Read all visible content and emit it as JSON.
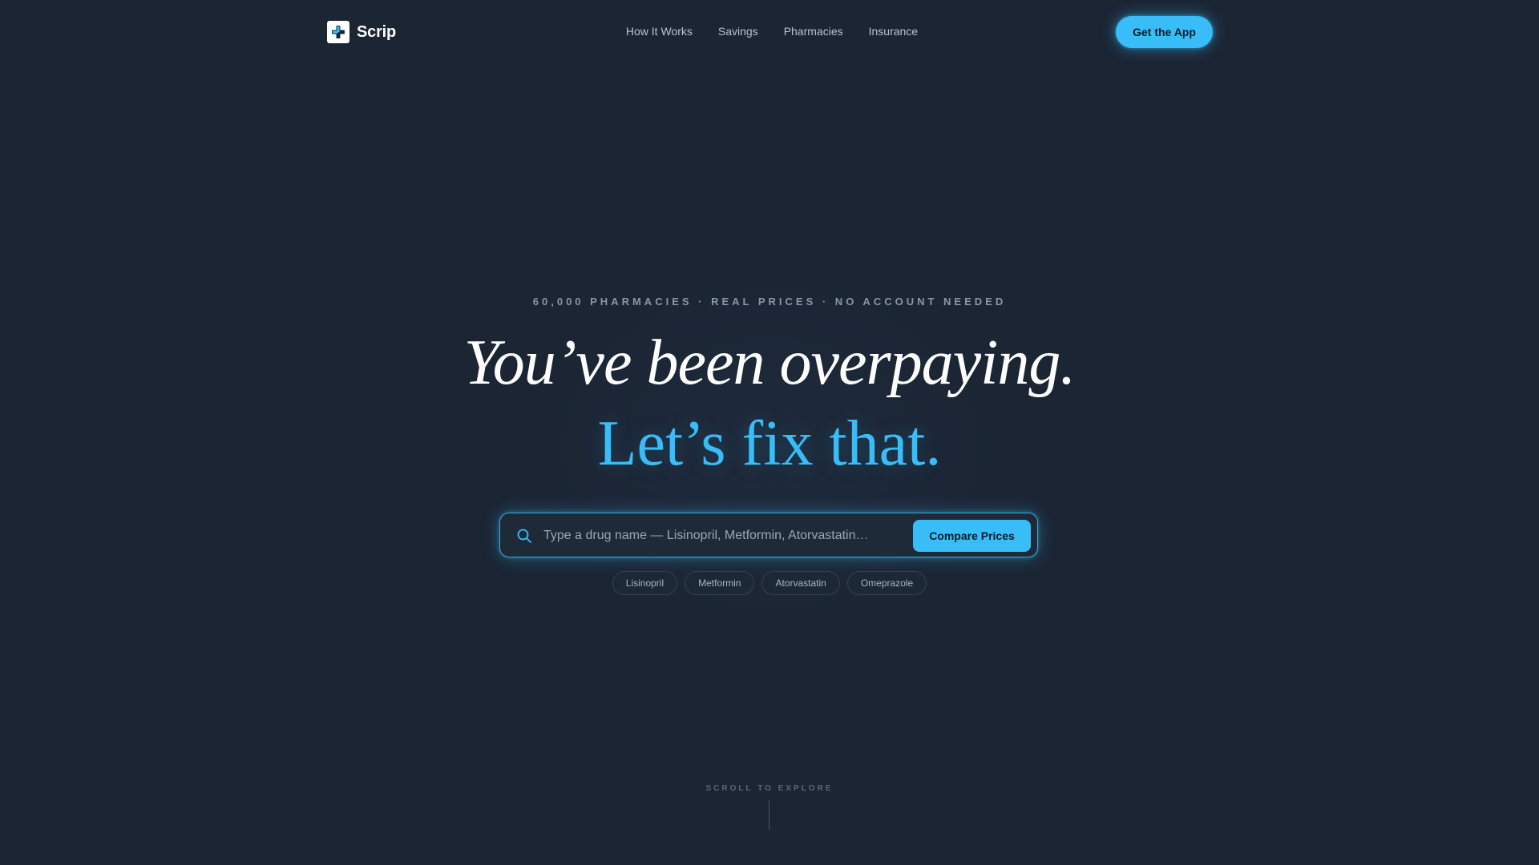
{
  "brand": {
    "name": "Scrip",
    "logo_icon": "medical-cross-logo-icon",
    "accent_color": "#38bdf8",
    "background_color": "#1b2534"
  },
  "nav": {
    "links": [
      {
        "label": "How It Works"
      },
      {
        "label": "Savings"
      },
      {
        "label": "Pharmacies"
      },
      {
        "label": "Insurance"
      }
    ],
    "cta_label": "Get the App"
  },
  "hero": {
    "eyebrow": "60,000 PHARMACIES · REAL PRICES · NO ACCOUNT NEEDED",
    "headline": "You’ve been overpaying.",
    "subheadline": "Let’s fix that."
  },
  "search": {
    "icon": "search-icon",
    "placeholder": "Type a drug name — Lisinopril, Metformin, Atorvastatin…",
    "value": "",
    "button_label": "Compare Prices"
  },
  "suggestions": [
    {
      "label": "Lisinopril"
    },
    {
      "label": "Metformin"
    },
    {
      "label": "Atorvastatin"
    },
    {
      "label": "Omeprazole"
    }
  ],
  "scroll_hint": {
    "label": "SCROLL TO EXPLORE"
  }
}
